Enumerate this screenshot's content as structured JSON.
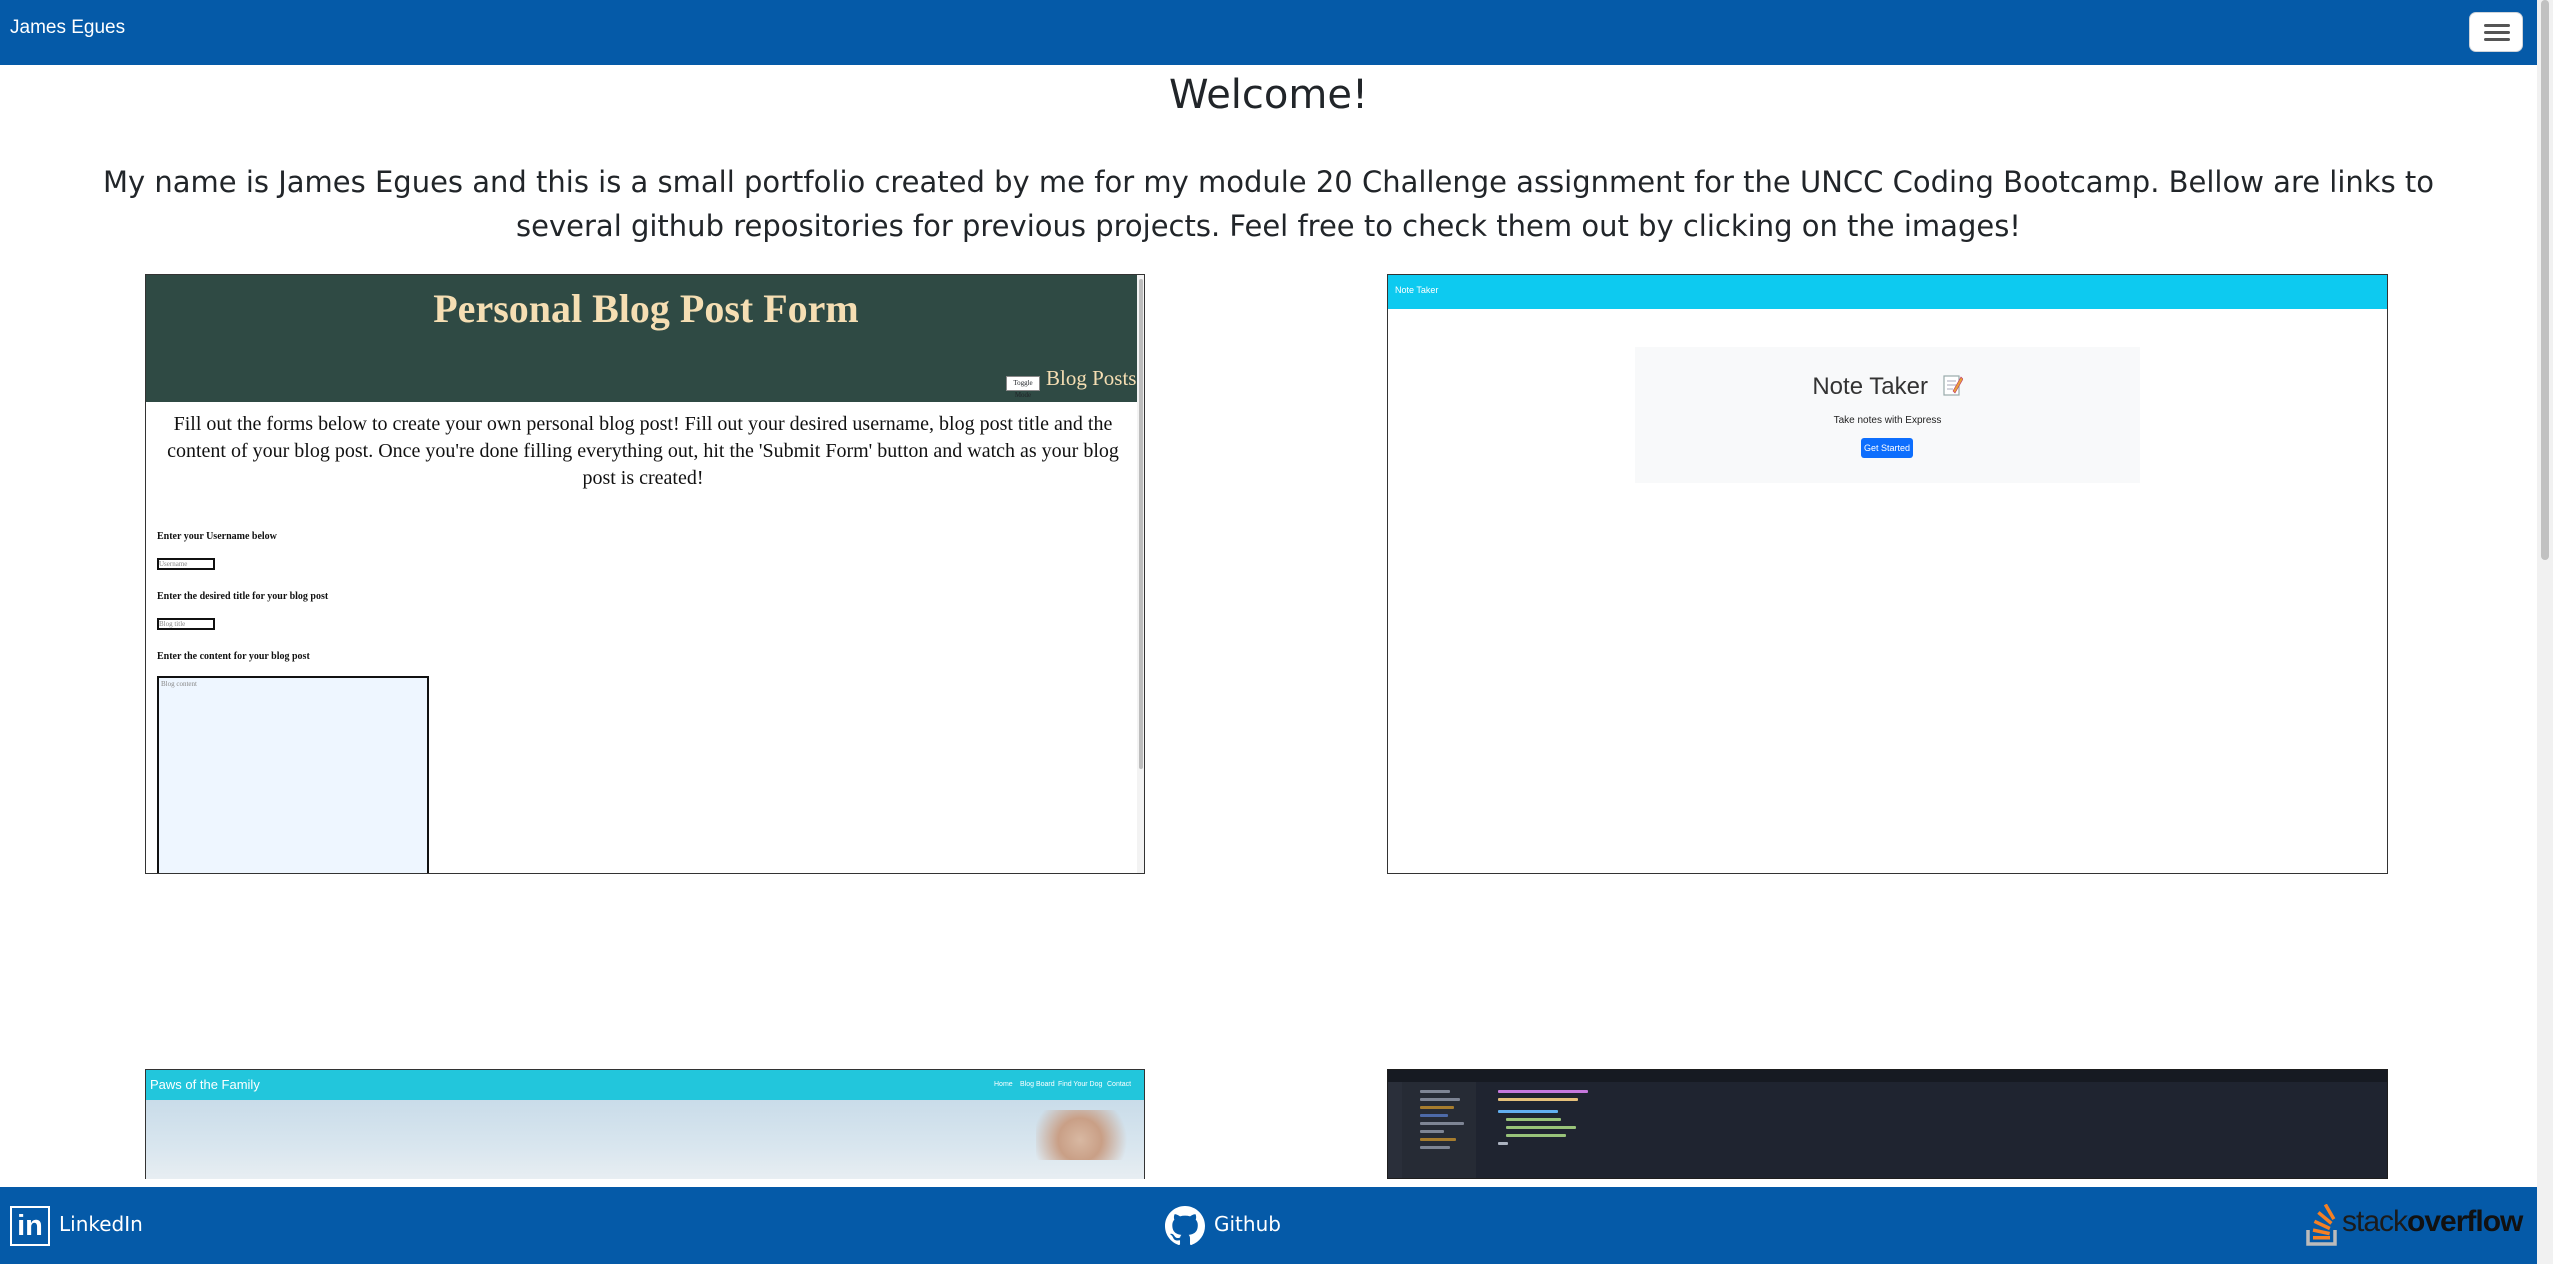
{
  "navbar": {
    "brand": "James Egues"
  },
  "main": {
    "heading": "Welcome!",
    "intro": "My name is James Egues and this is a small portfolio created by me for my module 20 Challenge assignment for the UNCC Coding Bootcamp. Bellow are links to several github repositories for previous projects. Feel free to check them out by clicking on the images!"
  },
  "projects": {
    "blog": {
      "title": "Personal Blog Post Form",
      "toggle_label": "Toggle Mode",
      "nav_link": "Blog Posts",
      "intro": "Fill out the forms below to create your own personal blog post! Fill out your desired username, blog post title and the content of your blog post. Once you're done filling everything out, hit the 'Submit Form' button and watch as your blog post is created!",
      "username_label": "Enter your Username below",
      "username_placeholder": "Username",
      "title_label": "Enter the desired title for your blog post",
      "title_placeholder": "Blog title",
      "content_label": "Enter the content for your blog post",
      "content_placeholder": "Blog content"
    },
    "notetaker": {
      "brand": "Note Taker",
      "title": "Note Taker",
      "title_icon": "memo-icon",
      "subtitle": "Take notes with Express",
      "button": "Get Started"
    },
    "paws": {
      "brand": "Paws of the Family",
      "nav": [
        "Home",
        "Blog Board",
        "Find Your Dog",
        "Contact"
      ]
    },
    "code": {
      "description": "code-editor-screenshot"
    }
  },
  "footer": {
    "linkedin_icon": "linkedin-icon",
    "linkedin_label": "LinkedIn",
    "linkedin_badge": "in",
    "github_icon": "github-icon",
    "github_label": "Github",
    "stackoverflow_icon": "stackoverflow-icon",
    "stackoverflow_a": "stack",
    "stackoverflow_b": "overflow"
  },
  "colors": {
    "navbar": "#055aa8",
    "blog_header": "#2f4a44",
    "blog_title": "#f5deb3",
    "notetaker_bar": "#0dcaf0",
    "notetaker_button": "#0d6efd",
    "paws_bar": "#22c6dc",
    "stackoverflow_orange": "#f48024"
  }
}
